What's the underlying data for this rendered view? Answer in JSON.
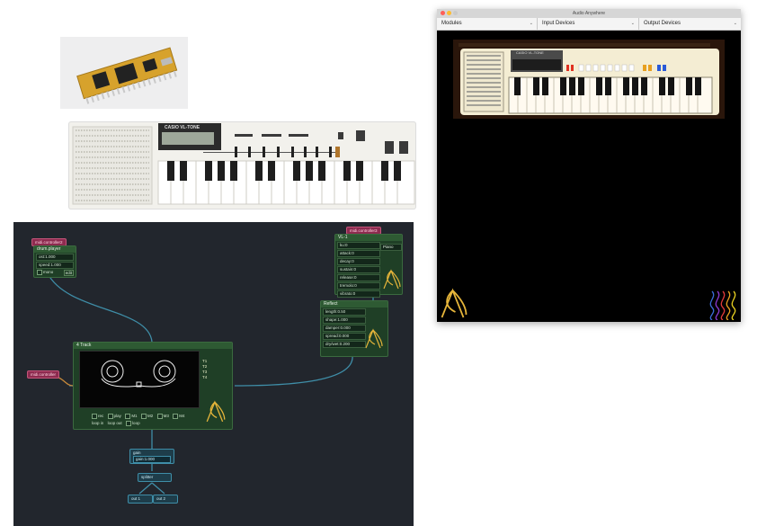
{
  "window": {
    "title": "Audio Anywhere",
    "menus": [
      {
        "label": "Modules"
      },
      {
        "label": "Input Devices"
      },
      {
        "label": "Output Devices"
      }
    ],
    "caret": "⌄"
  },
  "keyboard": {
    "brand": "CASIO VL-TONE",
    "nav_hint": "◀ ▶"
  },
  "editor": {
    "midi_controller_2": "midi.controller2",
    "midi_controller_3": "midi.controller3",
    "midi_controller_1": "midi.controller",
    "drum_player": {
      "title": "drum.player",
      "params": [
        "ost:1.000",
        "speed:1.000"
      ],
      "mono": "mono",
      "edit": "edit"
    },
    "vl1": {
      "title": "VL-1",
      "params": [
        "ku:0",
        "attack:0",
        "decay:0",
        "sustain:0",
        "release:0",
        "tremolo:0",
        "vibrato:0"
      ],
      "preset": "Piano"
    },
    "reflect": {
      "title": "Reflect",
      "params": [
        "length:0.50",
        "shape:1.000",
        "damper:0.000",
        "spread:0.000",
        "dry/wet:0.200"
      ]
    },
    "track": {
      "title": "4 Track",
      "tracks": [
        "T1",
        "T2",
        "T3",
        "T4"
      ],
      "buttons1": [
        "rec",
        "play",
        "M1",
        "M2",
        "M3",
        "M4"
      ],
      "buttons2": [
        "loop in",
        "loop out",
        "loop"
      ]
    },
    "gain": {
      "title": "gain",
      "param": "gain:1.000"
    },
    "splitter": "splitter",
    "outs": [
      "out 1",
      "out 2"
    ]
  },
  "colors": {
    "node_green": "#1f3f26",
    "cable_blue": "#3f8ea8",
    "pill_pink": "#8d2b4f",
    "logo_gold": "#e6b53a"
  }
}
